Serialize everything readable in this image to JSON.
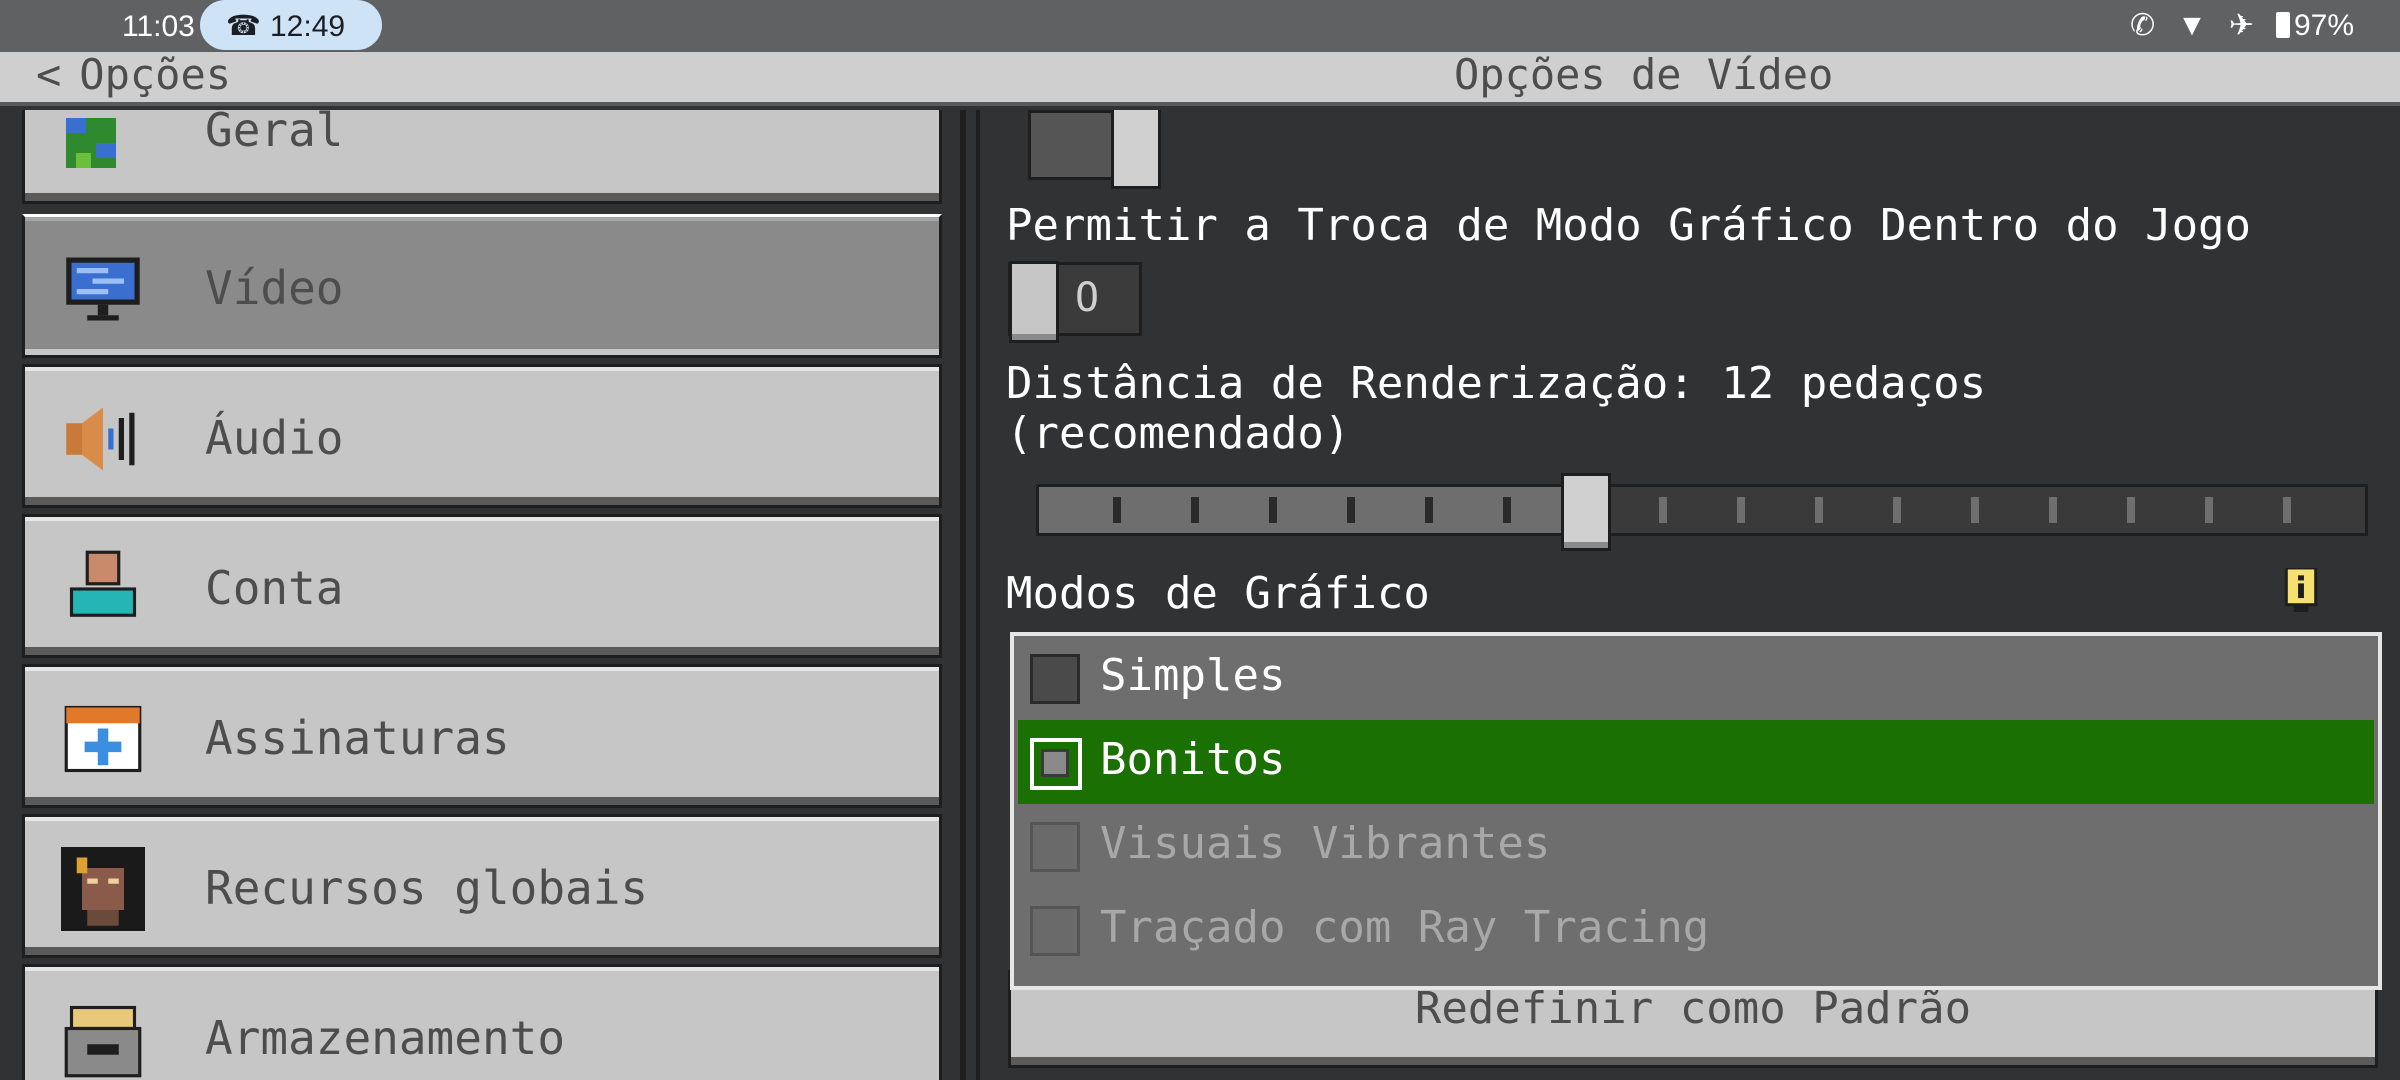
{
  "status_bar": {
    "time": "11:03",
    "call_time": "12:49",
    "battery": "97%",
    "icons": [
      "wifi-calling-icon",
      "wifi-icon",
      "airplane-icon",
      "battery-icon"
    ]
  },
  "header": {
    "back_label": "Opções",
    "title": "Opções de Vídeo"
  },
  "sidebar": {
    "items": [
      {
        "label": "Geral",
        "icon": "globe-icon"
      },
      {
        "label": "Vídeo",
        "icon": "monitor-icon",
        "active": true
      },
      {
        "label": "Áudio",
        "icon": "speaker-icon"
      },
      {
        "label": "Conta",
        "icon": "account-icon"
      },
      {
        "label": "Assinaturas",
        "icon": "calendar-add-icon"
      },
      {
        "label": "Recursos globais",
        "icon": "resource-pack-icon"
      },
      {
        "label": "Armazenamento",
        "icon": "storage-icon"
      }
    ]
  },
  "settings": {
    "graphics_toggle_label": "Permitir a Troca de Modo Gráfico Dentro do Jogo",
    "graphics_toggle_state": "O",
    "render_distance_line1": "Distância de Renderização: 12 pedaços",
    "render_distance_line2": "(recomendado)",
    "render_distance_value": 12,
    "render_distance_fraction": 0.41,
    "graphics_modes_label": "Modos de Gráfico",
    "graphics_options": [
      {
        "label": "Simples",
        "selected": false,
        "disabled": false
      },
      {
        "label": "Bonitos",
        "selected": true,
        "disabled": false
      },
      {
        "label": "Visuais Vibrantes",
        "selected": false,
        "disabled": true
      },
      {
        "label": "Traçado com Ray Tracing",
        "selected": false,
        "disabled": true
      }
    ],
    "reset_label": "Redefinir como Padrão"
  },
  "colors": {
    "selected_option": "#1a7002",
    "panel_bg": "#313233",
    "button_bg": "#c6c6c6"
  }
}
